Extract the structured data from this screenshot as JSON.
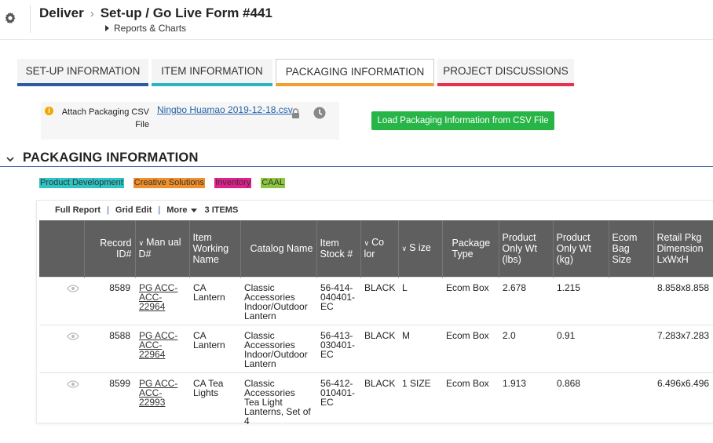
{
  "header": {
    "app_name": "Deliver",
    "title": "Set-up / Go Live Form #441",
    "subnav": "Reports & Charts"
  },
  "tabs": [
    {
      "label": "SET-UP INFORMATION",
      "color": "#2d5aa0"
    },
    {
      "label": "ITEM INFORMATION",
      "color": "#2bb5c0"
    },
    {
      "label": "PACKAGING INFORMATION",
      "color": "#f0a030",
      "active": true
    },
    {
      "label": "PROJECT DISCUSSIONS",
      "color": "#e8314d"
    }
  ],
  "attach": {
    "label": "Attach Packaging CSV File",
    "file_name": "Ningbo Huamao 2019-12-18.csv",
    "load_button": "Load Packaging Information from CSV File"
  },
  "section": {
    "title": "PACKAGING INFORMATION"
  },
  "legend": [
    {
      "label": "Product Development",
      "color": "#2ec4c4"
    },
    {
      "label": "Creative Solutions",
      "color": "#f0902a"
    },
    {
      "label": "Inventory",
      "color": "#e0208c"
    },
    {
      "label": "CAAL",
      "color": "#8cc63f"
    }
  ],
  "toolbar": {
    "full_report": "Full Report",
    "grid_edit": "Grid Edit",
    "more": "More",
    "count": "3 ITEMS"
  },
  "table": {
    "columns": [
      {
        "label": "Record ID#"
      },
      {
        "label": "Man ual D#"
      },
      {
        "label": "Item Working Name"
      },
      {
        "label": "Catalog Name"
      },
      {
        "label": "Item Stock #"
      },
      {
        "label": "Co lor"
      },
      {
        "label": "S ize"
      },
      {
        "label": "Package Type"
      },
      {
        "label": "Product Only Wt (lbs)"
      },
      {
        "label": "Product Only Wt (kg)"
      },
      {
        "label": "Ecom Bag Size"
      },
      {
        "label": "Retail Pkg Dimension LxWxH"
      }
    ],
    "rows": [
      {
        "record_id": "8589",
        "manual_id": "PG ACC-ACC-22964",
        "working_name": "CA Lantern",
        "catalog_name": "Classic Accessories Indoor/Outdoor Lantern",
        "stock": "56-414-040401-EC",
        "color": "BLACK",
        "size": "L",
        "package_type": "Ecom Box",
        "wt_lbs": "2.678",
        "wt_kg": "1.215",
        "ecom_bag": "",
        "retail_dim": "8.858x8.858"
      },
      {
        "record_id": "8588",
        "manual_id": "PG ACC-ACC-22964",
        "working_name": "CA Lantern",
        "catalog_name": "Classic Accessories Indoor/Outdoor Lantern",
        "stock": "56-413-030401-EC",
        "color": "BLACK",
        "size": "M",
        "package_type": "Ecom Box",
        "wt_lbs": "2.0",
        "wt_kg": "0.91",
        "ecom_bag": "",
        "retail_dim": "7.283x7.283"
      },
      {
        "record_id": "8599",
        "manual_id": "PG ACC-ACC-22993",
        "working_name": "CA Tea Lights",
        "catalog_name": "Classic Accessories Tea Light Lanterns, Set of 4",
        "stock": "56-412-010401-EC",
        "color": "BLACK",
        "size": "1 SIZE",
        "package_type": "Ecom Box",
        "wt_lbs": "1.913",
        "wt_kg": "0.868",
        "ecom_bag": "",
        "retail_dim": "6.496x6.496"
      }
    ]
  }
}
